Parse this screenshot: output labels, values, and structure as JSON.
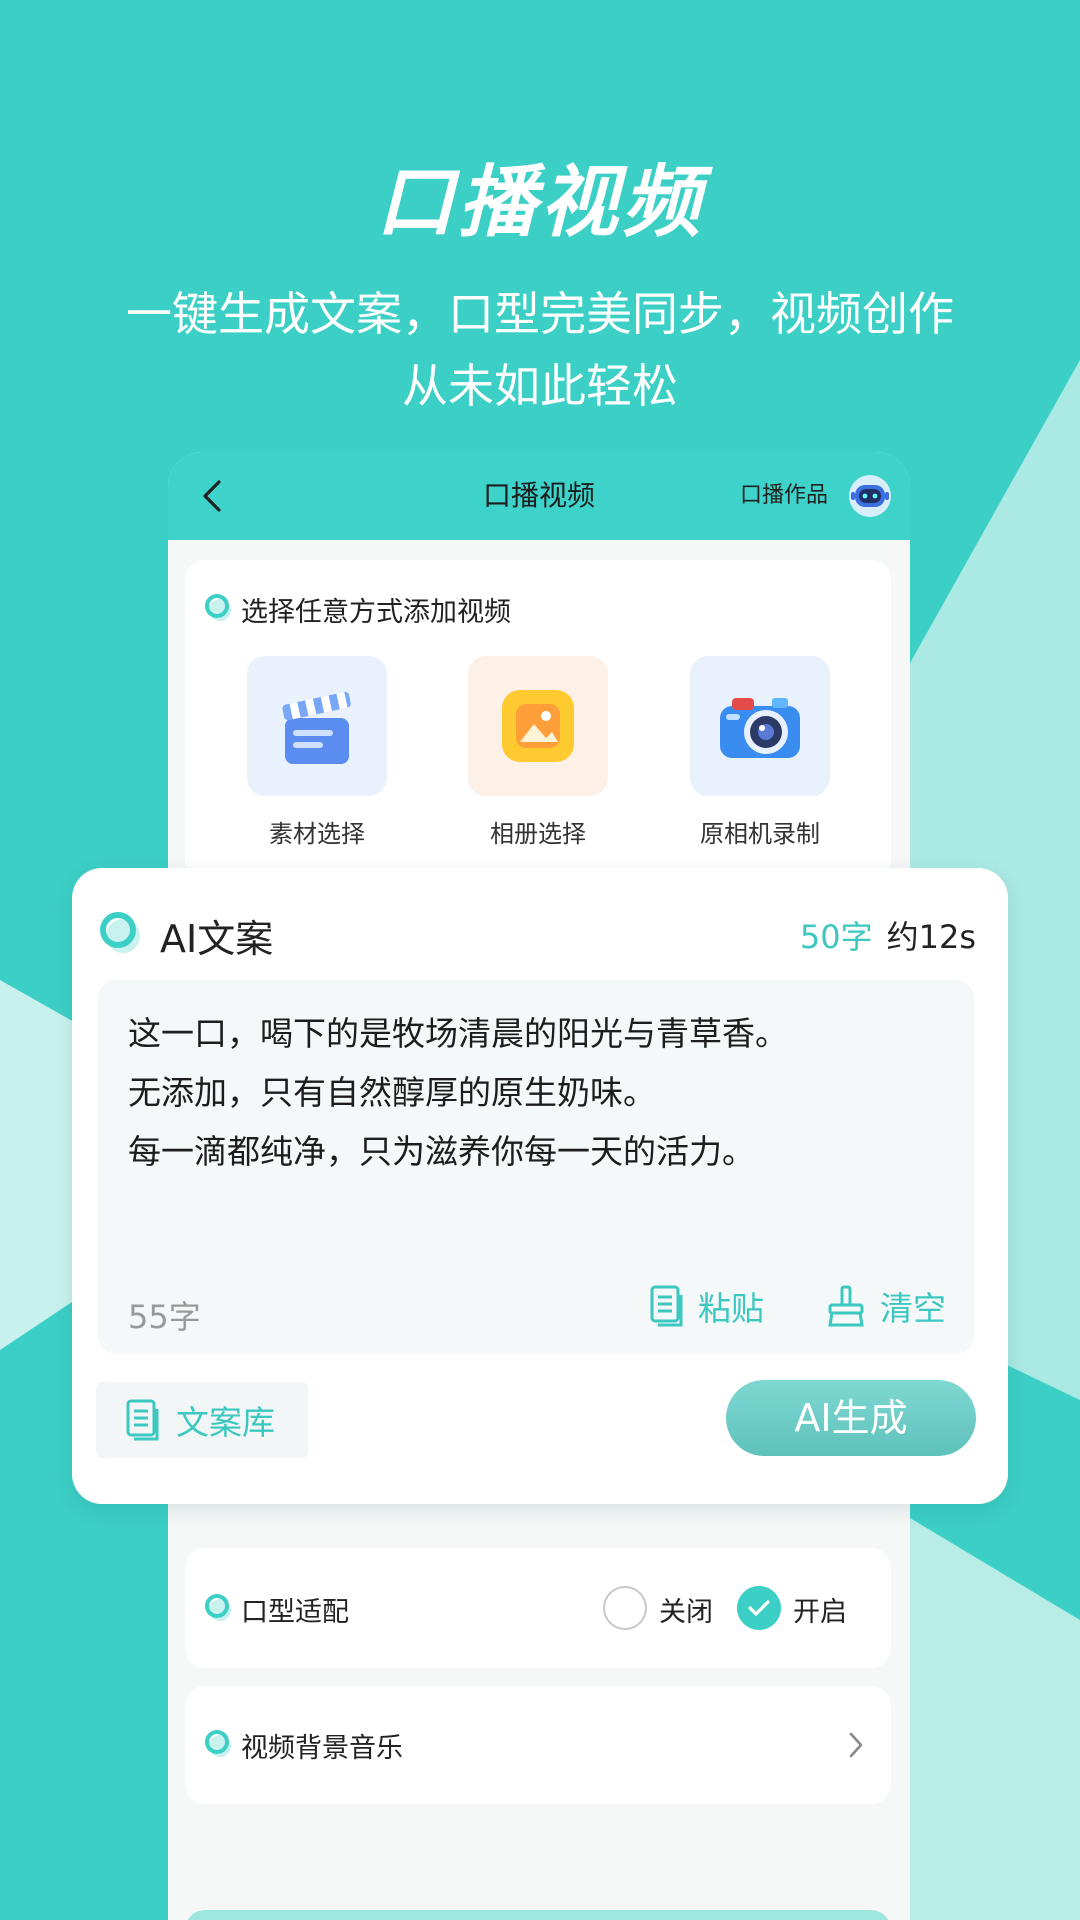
{
  "promo": {
    "title": "口播视频",
    "subtitle_line1": "一键生成文案，口型完美同步，视频创作",
    "subtitle_line2": "从未如此轻松"
  },
  "colors": {
    "brand_teal": "#3ccfc6",
    "header_teal": "#3dd3cb",
    "accent_text": "#3cc8c0"
  },
  "phone": {
    "header": {
      "back_icon": "chevron-left-icon",
      "title": "口播视频",
      "works_label": "口播作品",
      "robot_icon": "robot-avatar-icon"
    },
    "add_video": {
      "label": "选择任意方式添加视频",
      "options": [
        {
          "label": "素材选择",
          "icon": "clapperboard-icon"
        },
        {
          "label": "相册选择",
          "icon": "photo-album-icon"
        },
        {
          "label": "原相机录制",
          "icon": "camera-icon"
        }
      ]
    },
    "lip_sync": {
      "label": "口型适配",
      "off_label": "关闭",
      "on_label": "开启",
      "selected": "开启"
    },
    "bg_music": {
      "label": "视频背景音乐",
      "arrow_icon": "chevron-right-icon"
    }
  },
  "ai_copy": {
    "title": "AI文案",
    "word_count": "50字",
    "duration": "约12s",
    "lines": [
      "这一口，喝下的是牧场清晨的阳光与青草香。",
      "无添加，只有自然醇厚的原生奶味。",
      "每一滴都纯净，只为滋养你每一天的活力。"
    ],
    "length": "55字",
    "paste_label": "粘贴",
    "clear_label": "清空",
    "library_label": "文案库",
    "generate_label": "AI生成"
  }
}
